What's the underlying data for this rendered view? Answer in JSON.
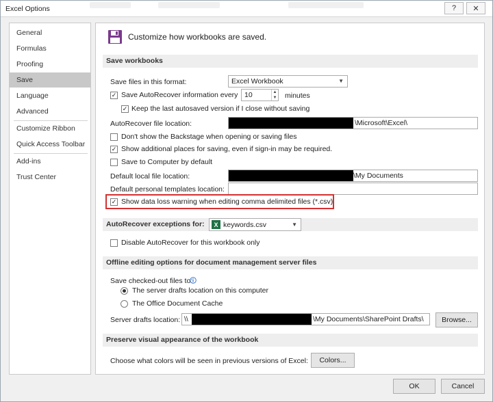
{
  "window": {
    "title": "Excel Options",
    "help_icon": "?",
    "close_icon": "✕"
  },
  "sidebar": {
    "items": [
      {
        "label": "General"
      },
      {
        "label": "Formulas"
      },
      {
        "label": "Proofing"
      },
      {
        "label": "Save",
        "active": true
      },
      {
        "label": "Language"
      },
      {
        "label": "Advanced"
      },
      {
        "label": "Customize Ribbon"
      },
      {
        "label": "Quick Access Toolbar"
      },
      {
        "label": "Add-ins"
      },
      {
        "label": "Trust Center"
      }
    ]
  },
  "header": {
    "icon": "save-disk-icon",
    "text": "Customize how workbooks are saved."
  },
  "save_workbooks": {
    "title": "Save workbooks",
    "format_label": "Save files in this format:",
    "format_value": "Excel Workbook",
    "autorecover_label": "Save AutoRecover information every",
    "autorecover_checked": true,
    "autorecover_minutes": "10",
    "minutes_label": "minutes",
    "keep_last_label": "Keep the last autosaved version if I close without saving",
    "keep_last_checked": true,
    "ar_location_label": "AutoRecover file location:",
    "ar_location_value": "\\Microsoft\\Excel\\",
    "backstage_label": "Don't show the Backstage when opening or saving files",
    "backstage_checked": false,
    "additional_places_label": "Show additional places for saving, even if sign-in may be required.",
    "additional_places_checked": true,
    "save_to_computer_label": "Save to Computer by default",
    "save_to_computer_checked": false,
    "local_file_label": "Default local file location:",
    "local_file_value": "\\My Documents",
    "templates_label": "Default personal templates location:",
    "templates_value": "",
    "data_loss_label": "Show data loss warning when editing comma delimited files (*.csv)",
    "data_loss_checked": true
  },
  "autorecover_exceptions": {
    "title": "AutoRecover exceptions for:",
    "file_value": "keywords.csv",
    "file_icon": "excel-file-icon",
    "disable_label": "Disable AutoRecover for this workbook only",
    "disable_checked": false
  },
  "offline_editing": {
    "title": "Offline editing options for document management server files",
    "checked_out_label": "Save checked-out files to:",
    "info_icon": "info-icon",
    "radio_server_label": "The server drafts location on this computer",
    "radio_server_selected": true,
    "radio_cache_label": "The Office Document Cache",
    "radio_cache_selected": false,
    "drafts_label": "Server drafts location:",
    "drafts_prefix": "\\\\",
    "drafts_suffix": "\\My Documents\\SharePoint Drafts\\",
    "browse_label": "Browse..."
  },
  "preserve": {
    "title": "Preserve visual appearance of the workbook",
    "colors_text": "Choose what colors will be seen in previous versions of Excel:",
    "colors_button": "Colors..."
  },
  "footer": {
    "ok_label": "OK",
    "cancel_label": "Cancel"
  },
  "colors": {
    "highlight_border": "#d43030",
    "excel_green": "#1e7145",
    "save_icon_purple": "#7a3a8c"
  }
}
